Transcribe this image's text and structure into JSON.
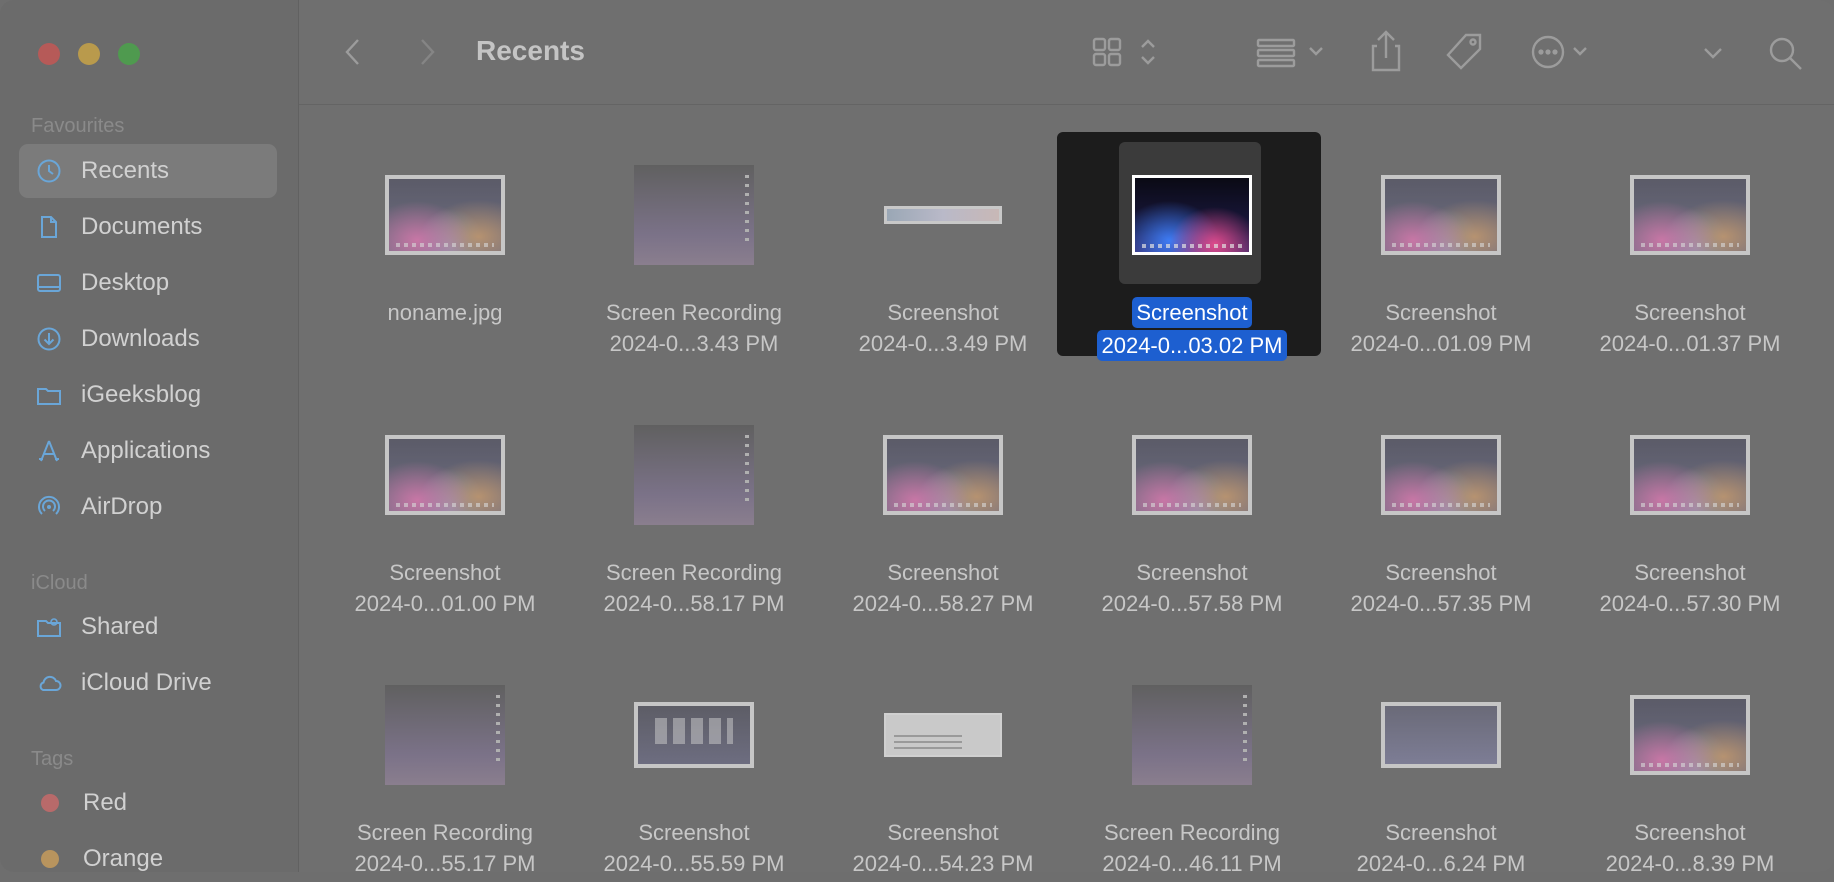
{
  "window": {
    "title": "Recents"
  },
  "sidebar": {
    "favourites_header": "Favourites",
    "favourites": [
      {
        "label": "Recents",
        "icon": "clock-icon",
        "active": true
      },
      {
        "label": "Documents",
        "icon": "document-icon"
      },
      {
        "label": "Desktop",
        "icon": "desktop-icon"
      },
      {
        "label": "Downloads",
        "icon": "download-icon"
      },
      {
        "label": "iGeeksblog",
        "icon": "folder-icon"
      },
      {
        "label": "Applications",
        "icon": "applications-icon"
      },
      {
        "label": "AirDrop",
        "icon": "airdrop-icon"
      }
    ],
    "icloud_header": "iCloud",
    "icloud": [
      {
        "label": "Shared",
        "icon": "shared-folder-icon"
      },
      {
        "label": "iCloud Drive",
        "icon": "cloud-icon"
      }
    ],
    "tags_header": "Tags",
    "tags": [
      {
        "label": "Red",
        "color": "#b86a6a"
      },
      {
        "label": "Orange",
        "color": "#b8945e"
      }
    ]
  },
  "colors": {
    "accent": "#1d5fd0",
    "icon": "#6aa6d8"
  },
  "files": [
    {
      "line1": "noname.jpg",
      "line2": "",
      "style": "screen"
    },
    {
      "line1": "Screen Recording",
      "line2": "2024-0...3.43 PM",
      "style": "grey"
    },
    {
      "line1": "Screenshot",
      "line2": "2024-0...3.49 PM",
      "style": "strip"
    },
    {
      "line1": "Screenshot",
      "line2": "2024-0...03.02 PM",
      "style": "sel",
      "selected": true
    },
    {
      "line1": "Screenshot",
      "line2": "2024-0...01.09 PM",
      "style": "screen"
    },
    {
      "line1": "Screenshot",
      "line2": "2024-0...01.37 PM",
      "style": "screen"
    },
    {
      "line1": "Screenshot",
      "line2": "2024-0...01.00 PM",
      "style": "screen"
    },
    {
      "line1": "Screen Recording",
      "line2": "2024-0...58.17 PM",
      "style": "grey"
    },
    {
      "line1": "Screenshot",
      "line2": "2024-0...58.27 PM",
      "style": "screen"
    },
    {
      "line1": "Screenshot",
      "line2": "2024-0...57.58 PM",
      "style": "screen"
    },
    {
      "line1": "Screenshot",
      "line2": "2024-0...57.35 PM",
      "style": "screen"
    },
    {
      "line1": "Screenshot",
      "line2": "2024-0...57.30 PM",
      "style": "screen"
    },
    {
      "line1": "Screen Recording",
      "line2": "2024-0...55.17 PM",
      "style": "grey"
    },
    {
      "line1": "Screenshot",
      "line2": "2024-0...55.59 PM",
      "style": "apps"
    },
    {
      "line1": "Screenshot",
      "line2": "2024-0...54.23 PM",
      "style": "doc"
    },
    {
      "line1": "Screen Recording",
      "line2": "2024-0...46.11 PM",
      "style": "grey"
    },
    {
      "line1": "Screenshot",
      "line2": "2024-0...6.24 PM",
      "style": "blank"
    },
    {
      "line1": "Screenshot",
      "line2": "2024-0...8.39 PM",
      "style": "screen"
    }
  ]
}
